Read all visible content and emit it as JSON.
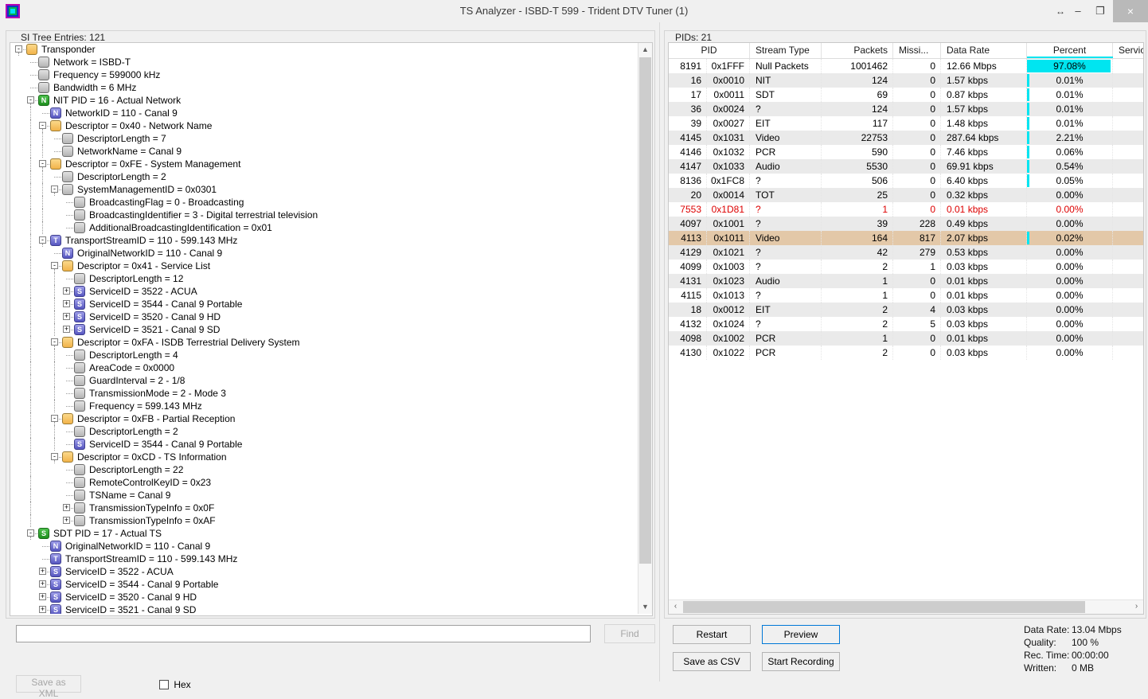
{
  "window": {
    "title": "TS Analyzer - ISBD-T 599 - Trident DTV Tuner (1)",
    "app_icon": "ts-analyzer-logo-icon",
    "controls": {
      "resize": "↔",
      "minimize": "–",
      "maximize": "❐",
      "close": "×"
    }
  },
  "tree_panel": {
    "group_label": "SI Tree Entries: 121",
    "scrollbar": {
      "up": "▲",
      "down": "▼"
    },
    "nodes": [
      {
        "depth": 0,
        "exp": "-",
        "icon": "folder",
        "glyph": "",
        "label": "Transponder"
      },
      {
        "depth": 1,
        "exp": "",
        "icon": "gray",
        "glyph": "",
        "label": "Network = ISBD-T"
      },
      {
        "depth": 1,
        "exp": "",
        "icon": "gray",
        "glyph": "",
        "label": "Frequency = 599000 kHz"
      },
      {
        "depth": 1,
        "exp": "",
        "icon": "gray",
        "glyph": "",
        "label": "Bandwidth = 6 MHz"
      },
      {
        "depth": 1,
        "exp": "-",
        "icon": "greenN",
        "glyph": "N",
        "label": "NIT PID = 16 - Actual Network"
      },
      {
        "depth": 2,
        "exp": "",
        "icon": "blueN",
        "glyph": "N",
        "label": "NetworkID = 110 - Canal 9"
      },
      {
        "depth": 2,
        "exp": "-",
        "icon": "folder",
        "glyph": "",
        "label": "Descriptor = 0x40 - Network Name"
      },
      {
        "depth": 3,
        "exp": "",
        "icon": "gray",
        "glyph": "",
        "label": "DescriptorLength = 7"
      },
      {
        "depth": 3,
        "exp": "",
        "icon": "gray",
        "glyph": "",
        "label": "NetworkName = Canal 9"
      },
      {
        "depth": 2,
        "exp": "-",
        "icon": "folder",
        "glyph": "",
        "label": "Descriptor = 0xFE - System Management"
      },
      {
        "depth": 3,
        "exp": "",
        "icon": "gray",
        "glyph": "",
        "label": "DescriptorLength = 2"
      },
      {
        "depth": 3,
        "exp": "-",
        "icon": "gray",
        "glyph": "",
        "label": "SystemManagementID = 0x0301"
      },
      {
        "depth": 4,
        "exp": "",
        "icon": "gray",
        "glyph": "",
        "label": "BroadcastingFlag = 0 - Broadcasting"
      },
      {
        "depth": 4,
        "exp": "",
        "icon": "gray",
        "glyph": "",
        "label": "BroadcastingIdentifier = 3 - Digital terrestrial television"
      },
      {
        "depth": 4,
        "exp": "",
        "icon": "gray",
        "glyph": "",
        "label": "AdditionalBroadcastingIdentification = 0x01"
      },
      {
        "depth": 2,
        "exp": "-",
        "icon": "blueT",
        "glyph": "T",
        "label": "TransportStreamID = 110 - 599.143 MHz"
      },
      {
        "depth": 3,
        "exp": "",
        "icon": "blueN",
        "glyph": "N",
        "label": "OriginalNetworkID = 110 - Canal 9"
      },
      {
        "depth": 3,
        "exp": "-",
        "icon": "folder",
        "glyph": "",
        "label": "Descriptor = 0x41 - Service List"
      },
      {
        "depth": 4,
        "exp": "",
        "icon": "gray",
        "glyph": "",
        "label": "DescriptorLength = 12"
      },
      {
        "depth": 4,
        "exp": "+",
        "icon": "blueS",
        "glyph": "S",
        "label": "ServiceID = 3522 - ACUA"
      },
      {
        "depth": 4,
        "exp": "+",
        "icon": "blueS",
        "glyph": "S",
        "label": "ServiceID = 3544 - Canal 9 Portable"
      },
      {
        "depth": 4,
        "exp": "+",
        "icon": "blueS",
        "glyph": "S",
        "label": "ServiceID = 3520 - Canal 9 HD"
      },
      {
        "depth": 4,
        "exp": "+",
        "icon": "blueS",
        "glyph": "S",
        "label": "ServiceID = 3521 - Canal 9 SD"
      },
      {
        "depth": 3,
        "exp": "-",
        "icon": "folder",
        "glyph": "",
        "label": "Descriptor = 0xFA - ISDB Terrestrial Delivery System"
      },
      {
        "depth": 4,
        "exp": "",
        "icon": "gray",
        "glyph": "",
        "label": "DescriptorLength = 4"
      },
      {
        "depth": 4,
        "exp": "",
        "icon": "gray",
        "glyph": "",
        "label": "AreaCode = 0x0000"
      },
      {
        "depth": 4,
        "exp": "",
        "icon": "gray",
        "glyph": "",
        "label": "GuardInterval = 2 - 1/8"
      },
      {
        "depth": 4,
        "exp": "",
        "icon": "gray",
        "glyph": "",
        "label": "TransmissionMode = 2 - Mode 3"
      },
      {
        "depth": 4,
        "exp": "",
        "icon": "gray",
        "glyph": "",
        "label": "Frequency = 599.143 MHz"
      },
      {
        "depth": 3,
        "exp": "-",
        "icon": "folder",
        "glyph": "",
        "label": "Descriptor = 0xFB - Partial Reception"
      },
      {
        "depth": 4,
        "exp": "",
        "icon": "gray",
        "glyph": "",
        "label": "DescriptorLength = 2"
      },
      {
        "depth": 4,
        "exp": "",
        "icon": "blueS",
        "glyph": "S",
        "label": "ServiceID = 3544 - Canal 9 Portable"
      },
      {
        "depth": 3,
        "exp": "-",
        "icon": "folder",
        "glyph": "",
        "label": "Descriptor = 0xCD - TS Information"
      },
      {
        "depth": 4,
        "exp": "",
        "icon": "gray",
        "glyph": "",
        "label": "DescriptorLength = 22"
      },
      {
        "depth": 4,
        "exp": "",
        "icon": "gray",
        "glyph": "",
        "label": "RemoteControlKeyID = 0x23"
      },
      {
        "depth": 4,
        "exp": "",
        "icon": "gray",
        "glyph": "",
        "label": "TSName = Canal 9"
      },
      {
        "depth": 4,
        "exp": "+",
        "icon": "gray",
        "glyph": "",
        "label": "TransmissionTypeInfo = 0x0F"
      },
      {
        "depth": 4,
        "exp": "+",
        "icon": "gray",
        "glyph": "",
        "label": "TransmissionTypeInfo = 0xAF"
      },
      {
        "depth": 1,
        "exp": "-",
        "icon": "greenS",
        "glyph": "S",
        "label": "SDT PID = 17 - Actual TS"
      },
      {
        "depth": 2,
        "exp": "",
        "icon": "blueN",
        "glyph": "N",
        "label": "OriginalNetworkID = 110 - Canal 9"
      },
      {
        "depth": 2,
        "exp": "",
        "icon": "blueT",
        "glyph": "T",
        "label": "TransportStreamID = 110 - 599.143 MHz"
      },
      {
        "depth": 2,
        "exp": "+",
        "icon": "blueS",
        "glyph": "S",
        "label": "ServiceID = 3522 - ACUA"
      },
      {
        "depth": 2,
        "exp": "+",
        "icon": "blueS",
        "glyph": "S",
        "label": "ServiceID = 3544 - Canal 9 Portable"
      },
      {
        "depth": 2,
        "exp": "+",
        "icon": "blueS",
        "glyph": "S",
        "label": "ServiceID = 3520 - Canal 9 HD"
      },
      {
        "depth": 2,
        "exp": "+",
        "icon": "blueS",
        "glyph": "S",
        "label": "ServiceID = 3521 - Canal 9 SD"
      }
    ]
  },
  "find_bar": {
    "input_value": "",
    "input_placeholder": "",
    "find_label": "Find",
    "save_xml_label": "Save as XML",
    "hex_label": "Hex",
    "hex_checked": false
  },
  "pids_panel": {
    "group_label": "PIDs: 21",
    "columns": [
      "PID",
      "Stream Type",
      "Packets",
      "Missi...",
      "Data Rate",
      "Percent",
      "Service"
    ],
    "scrollbar": {
      "left": "‹",
      "right": "›"
    },
    "highlight_color": "#00e5f0",
    "selected_row_color": "#e3c8a8",
    "error_text_color": "#dd0000",
    "rows": [
      {
        "pid": "8191",
        "hex": "0x1FFF",
        "type": "Null Packets",
        "packets": "1001462",
        "missing": "0",
        "rate": "12.66 Mbps",
        "percent": "97.08%",
        "pct": 97.08,
        "service": "",
        "state": "normal"
      },
      {
        "pid": "16",
        "hex": "0x0010",
        "type": "NIT",
        "packets": "124",
        "missing": "0",
        "rate": "1.57 kbps",
        "percent": "0.01%",
        "pct": 0.01,
        "service": "",
        "state": "alt"
      },
      {
        "pid": "17",
        "hex": "0x0011",
        "type": "SDT",
        "packets": "69",
        "missing": "0",
        "rate": "0.87 kbps",
        "percent": "0.01%",
        "pct": 0.01,
        "service": "",
        "state": "normal"
      },
      {
        "pid": "36",
        "hex": "0x0024",
        "type": "?",
        "packets": "124",
        "missing": "0",
        "rate": "1.57 kbps",
        "percent": "0.01%",
        "pct": 0.01,
        "service": "",
        "state": "alt"
      },
      {
        "pid": "39",
        "hex": "0x0027",
        "type": "EIT",
        "packets": "117",
        "missing": "0",
        "rate": "1.48 kbps",
        "percent": "0.01%",
        "pct": 0.01,
        "service": "",
        "state": "normal"
      },
      {
        "pid": "4145",
        "hex": "0x1031",
        "type": "Video",
        "packets": "22753",
        "missing": "0",
        "rate": "287.64 kbps",
        "percent": "2.21%",
        "pct": 2.21,
        "service": "",
        "state": "alt"
      },
      {
        "pid": "4146",
        "hex": "0x1032",
        "type": "PCR",
        "packets": "590",
        "missing": "0",
        "rate": "7.46 kbps",
        "percent": "0.06%",
        "pct": 0.06,
        "service": "",
        "state": "normal"
      },
      {
        "pid": "4147",
        "hex": "0x1033",
        "type": "Audio",
        "packets": "5530",
        "missing": "0",
        "rate": "69.91 kbps",
        "percent": "0.54%",
        "pct": 0.54,
        "service": "",
        "state": "alt"
      },
      {
        "pid": "8136",
        "hex": "0x1FC8",
        "type": "?",
        "packets": "506",
        "missing": "0",
        "rate": "6.40 kbps",
        "percent": "0.05%",
        "pct": 0.05,
        "service": "",
        "state": "normal"
      },
      {
        "pid": "20",
        "hex": "0x0014",
        "type": "TOT",
        "packets": "25",
        "missing": "0",
        "rate": "0.32 kbps",
        "percent": "0.00%",
        "pct": 0.0,
        "service": "",
        "state": "alt"
      },
      {
        "pid": "7553",
        "hex": "0x1D81",
        "type": "?",
        "packets": "1",
        "missing": "0",
        "rate": "0.01 kbps",
        "percent": "0.00%",
        "pct": 0.0,
        "service": "",
        "state": "error"
      },
      {
        "pid": "4097",
        "hex": "0x1001",
        "type": "?",
        "packets": "39",
        "missing": "228",
        "rate": "0.49 kbps",
        "percent": "0.00%",
        "pct": 0.0,
        "service": "",
        "state": "alt"
      },
      {
        "pid": "4113",
        "hex": "0x1011",
        "type": "Video",
        "packets": "164",
        "missing": "817",
        "rate": "2.07 kbps",
        "percent": "0.02%",
        "pct": 0.02,
        "service": "",
        "state": "selected"
      },
      {
        "pid": "4129",
        "hex": "0x1021",
        "type": "?",
        "packets": "42",
        "missing": "279",
        "rate": "0.53 kbps",
        "percent": "0.00%",
        "pct": 0.0,
        "service": "",
        "state": "alt"
      },
      {
        "pid": "4099",
        "hex": "0x1003",
        "type": "?",
        "packets": "2",
        "missing": "1",
        "rate": "0.03 kbps",
        "percent": "0.00%",
        "pct": 0.0,
        "service": "",
        "state": "normal"
      },
      {
        "pid": "4131",
        "hex": "0x1023",
        "type": "Audio",
        "packets": "1",
        "missing": "0",
        "rate": "0.01 kbps",
        "percent": "0.00%",
        "pct": 0.0,
        "service": "",
        "state": "alt"
      },
      {
        "pid": "4115",
        "hex": "0x1013",
        "type": "?",
        "packets": "1",
        "missing": "0",
        "rate": "0.01 kbps",
        "percent": "0.00%",
        "pct": 0.0,
        "service": "",
        "state": "normal"
      },
      {
        "pid": "18",
        "hex": "0x0012",
        "type": "EIT",
        "packets": "2",
        "missing": "4",
        "rate": "0.03 kbps",
        "percent": "0.00%",
        "pct": 0.0,
        "service": "",
        "state": "alt"
      },
      {
        "pid": "4132",
        "hex": "0x1024",
        "type": "?",
        "packets": "2",
        "missing": "5",
        "rate": "0.03 kbps",
        "percent": "0.00%",
        "pct": 0.0,
        "service": "",
        "state": "normal"
      },
      {
        "pid": "4098",
        "hex": "0x1002",
        "type": "PCR",
        "packets": "1",
        "missing": "0",
        "rate": "0.01 kbps",
        "percent": "0.00%",
        "pct": 0.0,
        "service": "",
        "state": "alt"
      },
      {
        "pid": "4130",
        "hex": "0x1022",
        "type": "PCR",
        "packets": "2",
        "missing": "0",
        "rate": "0.03 kbps",
        "percent": "0.00%",
        "pct": 0.0,
        "service": "",
        "state": "normal"
      }
    ]
  },
  "actions": {
    "restart_label": "Restart",
    "preview_label": "Preview",
    "save_csv_label": "Save as CSV",
    "start_recording_label": "Start Recording"
  },
  "status": {
    "rows": [
      {
        "label": "Data Rate:",
        "value": "13.04 Mbps"
      },
      {
        "label": "Quality:",
        "value": "100 %"
      },
      {
        "label": "Rec. Time:",
        "value": "00:00:00"
      },
      {
        "label": "Written:",
        "value": "0 MB"
      }
    ]
  }
}
